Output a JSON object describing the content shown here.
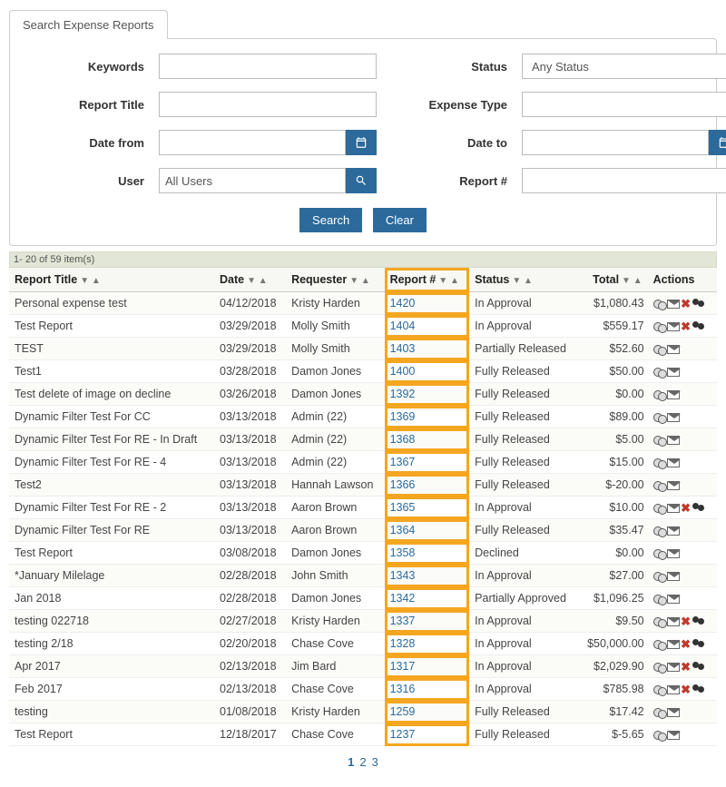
{
  "tab": "Search Expense Reports",
  "labels": {
    "keywords": "Keywords",
    "status": "Status",
    "report_title": "Report Title",
    "expense_type": "Expense Type",
    "date_from": "Date from",
    "date_to": "Date to",
    "user": "User",
    "report_no": "Report #"
  },
  "inputs": {
    "keywords": "",
    "status": "Any Status",
    "report_title": "",
    "expense_type": "",
    "date_from": "",
    "date_to": "",
    "user": "All Users",
    "report_no": ""
  },
  "buttons": {
    "search": "Search",
    "clear": "Clear"
  },
  "count": "1- 20 of 59 item(s)",
  "columns": {
    "title": "Report Title",
    "date": "Date",
    "requester": "Requester",
    "reportno": "Report #",
    "status": "Status",
    "total": "Total",
    "actions": "Actions"
  },
  "rows": [
    {
      "title": "Personal expense test",
      "date": "04/12/2018",
      "requester": "Kristy Harden",
      "reportno": "1420",
      "status": "In Approval",
      "total": "$1,080.43",
      "actions": [
        "coins",
        "env",
        "x",
        "users"
      ]
    },
    {
      "title": "Test Report",
      "date": "03/29/2018",
      "requester": "Molly Smith",
      "reportno": "1404",
      "status": "In Approval",
      "total": "$559.17",
      "actions": [
        "coins",
        "env",
        "x",
        "users"
      ]
    },
    {
      "title": "TEST",
      "date": "03/29/2018",
      "requester": "Molly Smith",
      "reportno": "1403",
      "status": "Partially Released",
      "total": "$52.60",
      "actions": [
        "coins",
        "env"
      ]
    },
    {
      "title": "Test1",
      "date": "03/28/2018",
      "requester": "Damon Jones",
      "reportno": "1400",
      "status": "Fully Released",
      "total": "$50.00",
      "actions": [
        "coins",
        "env"
      ]
    },
    {
      "title": "Test delete of image on decline",
      "date": "03/26/2018",
      "requester": "Damon Jones",
      "reportno": "1392",
      "status": "Fully Released",
      "total": "$0.00",
      "actions": [
        "coins",
        "env"
      ]
    },
    {
      "title": "Dynamic Filter Test For CC",
      "date": "03/13/2018",
      "requester": "Admin (22)",
      "reportno": "1369",
      "status": "Fully Released",
      "total": "$89.00",
      "actions": [
        "coins",
        "env"
      ]
    },
    {
      "title": "Dynamic Filter Test For RE - In Draft",
      "date": "03/13/2018",
      "requester": "Admin (22)",
      "reportno": "1368",
      "status": "Fully Released",
      "total": "$5.00",
      "actions": [
        "coins",
        "env"
      ]
    },
    {
      "title": "Dynamic Filter Test For RE - 4",
      "date": "03/13/2018",
      "requester": "Admin (22)",
      "reportno": "1367",
      "status": "Fully Released",
      "total": "$15.00",
      "actions": [
        "coins",
        "env"
      ]
    },
    {
      "title": "Test2",
      "date": "03/13/2018",
      "requester": "Hannah Lawson",
      "reportno": "1366",
      "status": "Fully Released",
      "total": "$-20.00",
      "actions": [
        "coins",
        "env"
      ]
    },
    {
      "title": "Dynamic Filter Test For RE - 2",
      "date": "03/13/2018",
      "requester": "Aaron Brown",
      "reportno": "1365",
      "status": "In Approval",
      "total": "$10.00",
      "actions": [
        "coins",
        "env",
        "x",
        "users"
      ]
    },
    {
      "title": "Dynamic Filter Test For RE",
      "date": "03/13/2018",
      "requester": "Aaron Brown",
      "reportno": "1364",
      "status": "Fully Released",
      "total": "$35.47",
      "actions": [
        "coins",
        "env"
      ]
    },
    {
      "title": "Test Report",
      "date": "03/08/2018",
      "requester": "Damon Jones",
      "reportno": "1358",
      "status": "Declined",
      "total": "$0.00",
      "actions": [
        "coins",
        "env"
      ]
    },
    {
      "title": "*January Milelage",
      "date": "02/28/2018",
      "requester": "John Smith",
      "reportno": "1343",
      "status": "In Approval",
      "total": "$27.00",
      "actions": [
        "coins",
        "env"
      ]
    },
    {
      "title": "Jan 2018",
      "date": "02/28/2018",
      "requester": "Damon Jones",
      "reportno": "1342",
      "status": "Partially Approved",
      "total": "$1,096.25",
      "actions": [
        "coins",
        "env"
      ]
    },
    {
      "title": "testing 022718",
      "date": "02/27/2018",
      "requester": "Kristy Harden",
      "reportno": "1337",
      "status": "In Approval",
      "total": "$9.50",
      "actions": [
        "coins",
        "env",
        "x",
        "users"
      ]
    },
    {
      "title": "testing 2/18",
      "date": "02/20/2018",
      "requester": "Chase Cove",
      "reportno": "1328",
      "status": "In Approval",
      "total": "$50,000.00",
      "actions": [
        "coins",
        "env",
        "x",
        "users"
      ]
    },
    {
      "title": "Apr 2017",
      "date": "02/13/2018",
      "requester": "Jim Bard",
      "reportno": "1317",
      "status": "In Approval",
      "total": "$2,029.90",
      "actions": [
        "coins",
        "env",
        "x",
        "users"
      ]
    },
    {
      "title": "Feb 2017",
      "date": "02/13/2018",
      "requester": "Chase Cove",
      "reportno": "1316",
      "status": "In Approval",
      "total": "$785.98",
      "actions": [
        "coins",
        "env",
        "x",
        "users"
      ]
    },
    {
      "title": "testing",
      "date": "01/08/2018",
      "requester": "Kristy Harden",
      "reportno": "1259",
      "status": "Fully Released",
      "total": "$17.42",
      "actions": [
        "coins",
        "env"
      ]
    },
    {
      "title": "Test Report",
      "date": "12/18/2017",
      "requester": "Chase Cove",
      "reportno": "1237",
      "status": "Fully Released",
      "total": "$-5.65",
      "actions": [
        "coins",
        "env"
      ]
    }
  ],
  "pager": {
    "current": "1",
    "pages": [
      "1",
      "2",
      "3"
    ]
  }
}
